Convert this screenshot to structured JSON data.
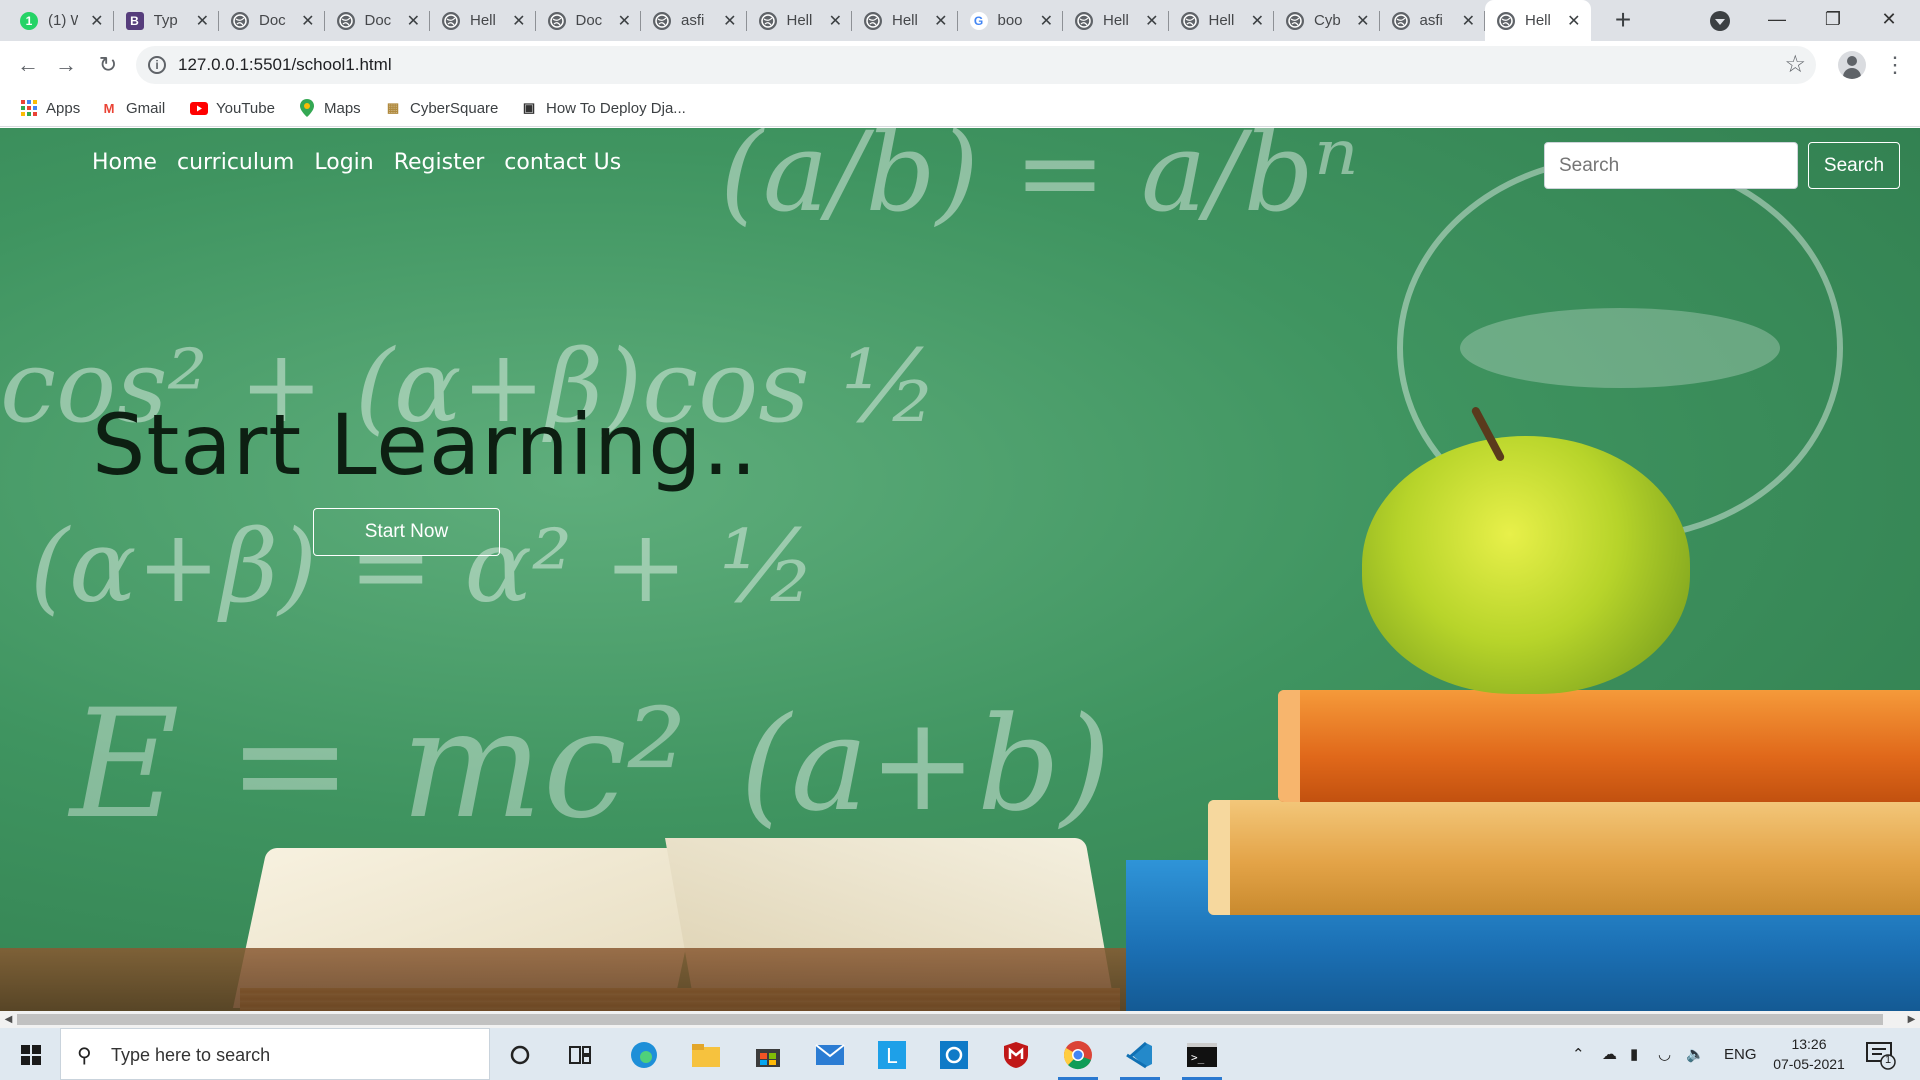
{
  "browser": {
    "tabs": [
      {
        "title": "(1) W",
        "favicon": "whatsapp-icon",
        "color": "#25d366",
        "glyph": "1"
      },
      {
        "title": "Typ",
        "favicon": "bootstrap-icon",
        "color": "#563d7c",
        "glyph": "B"
      },
      {
        "title": "Doc",
        "favicon": "globe-icon",
        "color": "#5f6368",
        "glyph": ""
      },
      {
        "title": "Doc",
        "favicon": "globe-icon",
        "color": "#5f6368",
        "glyph": ""
      },
      {
        "title": "Hell",
        "favicon": "globe-icon",
        "color": "#5f6368",
        "glyph": ""
      },
      {
        "title": "Doc",
        "favicon": "globe-icon",
        "color": "#5f6368",
        "glyph": ""
      },
      {
        "title": "asfi",
        "favicon": "globe-icon",
        "color": "#5f6368",
        "glyph": ""
      },
      {
        "title": "Hell",
        "favicon": "globe-icon",
        "color": "#5f6368",
        "glyph": ""
      },
      {
        "title": "Hell",
        "favicon": "globe-icon",
        "color": "#5f6368",
        "glyph": ""
      },
      {
        "title": "boo",
        "favicon": "google-icon",
        "color": "#4285f4",
        "glyph": "G"
      },
      {
        "title": "Hell",
        "favicon": "globe-icon",
        "color": "#5f6368",
        "glyph": ""
      },
      {
        "title": "Hell",
        "favicon": "globe-icon",
        "color": "#5f6368",
        "glyph": ""
      },
      {
        "title": "Cyb",
        "favicon": "globe-icon",
        "color": "#5f6368",
        "glyph": ""
      },
      {
        "title": "asfi",
        "favicon": "globe-icon",
        "color": "#5f6368",
        "glyph": ""
      },
      {
        "title": "Hell",
        "favicon": "globe-icon",
        "color": "#5f6368",
        "glyph": "",
        "active": true
      }
    ],
    "url": "127.0.0.1:5501/school1.html",
    "bookmarks": [
      {
        "label": "Apps",
        "icon": "apps-grid-icon"
      },
      {
        "label": "Gmail",
        "icon": "gmail-icon"
      },
      {
        "label": "YouTube",
        "icon": "youtube-icon"
      },
      {
        "label": "Maps",
        "icon": "maps-icon"
      },
      {
        "label": "CyberSquare",
        "icon": "cybersquare-icon"
      },
      {
        "label": "How To Deploy Dja...",
        "icon": "page-icon"
      }
    ]
  },
  "page": {
    "nav": [
      "Home",
      "curriculum",
      "Login",
      "Register",
      "contact Us"
    ],
    "search": {
      "placeholder": "Search",
      "button": "Search"
    },
    "hero": {
      "title": "Start Learning..",
      "button": "Start Now"
    },
    "chalkboard_formulas": [
      "(a/b) = a/bⁿ",
      "cos² + (α+β)cos ½",
      "(α+β) = α² + ½",
      "E = mc²",
      "(a+b)"
    ]
  },
  "taskbar": {
    "search_placeholder": "Type here to search",
    "language": "ENG",
    "time": "13:26",
    "date": "07-05-2021",
    "notification_count": "1"
  },
  "colors": {
    "accent": "#2b79d0",
    "chalkboard": "#3f9460",
    "active_tab": "#ffffff"
  }
}
